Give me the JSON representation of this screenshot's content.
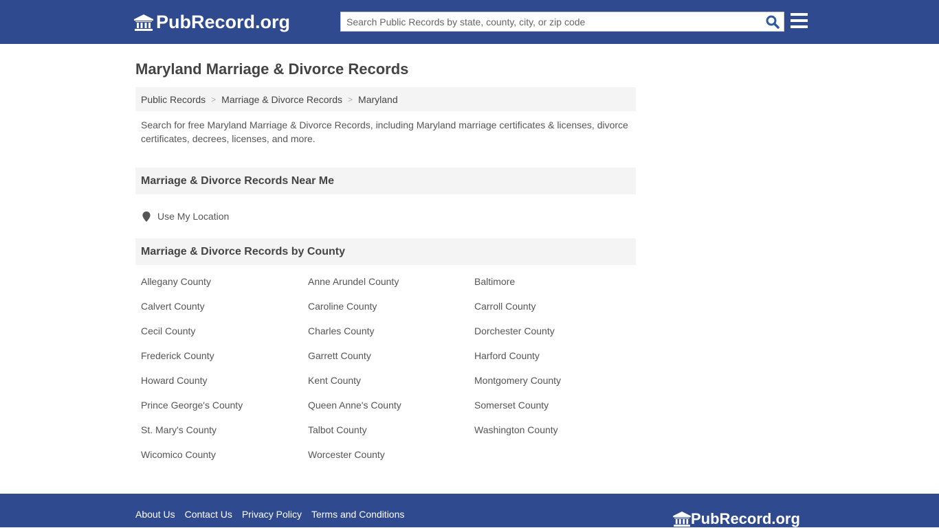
{
  "header": {
    "logo_text": "PubRecord.org",
    "search_placeholder": "Search Public Records by state, county, city, or zip code",
    "icons": [
      "bank-icon",
      "search-icon",
      "menu-icon"
    ]
  },
  "page": {
    "title": "Maryland Marriage & Divorce Records",
    "breadcrumb": [
      "Public Records",
      "Marriage & Divorce Records",
      "Maryland"
    ],
    "description": "Search for free Maryland Marriage & Divorce Records, including Maryland marriage certificates & licenses, divorce certificates, decrees, licenses, and more.",
    "near_me_heading": "Marriage & Divorce Records Near Me",
    "use_location": "Use My Location",
    "by_county_heading": "Marriage & Divorce Records by County",
    "counties": [
      "Allegany County",
      "Anne Arundel County",
      "Baltimore",
      "Calvert County",
      "Caroline County",
      "Carroll County",
      "Cecil County",
      "Charles County",
      "Dorchester County",
      "Frederick County",
      "Garrett County",
      "Harford County",
      "Howard County",
      "Kent County",
      "Montgomery County",
      "Prince George's County",
      "Queen Anne's County",
      "Somerset County",
      "St. Mary's County",
      "Talbot County",
      "Washington County",
      "Wicomico County",
      "Worcester County"
    ]
  },
  "footer": {
    "links": [
      "About Us",
      "Contact Us",
      "Privacy Policy",
      "Terms and Conditions"
    ],
    "logo_text": "PubRecord.org"
  },
  "colors": {
    "brand": "#2f4a8f",
    "search_icon": "#2f5a9e"
  }
}
